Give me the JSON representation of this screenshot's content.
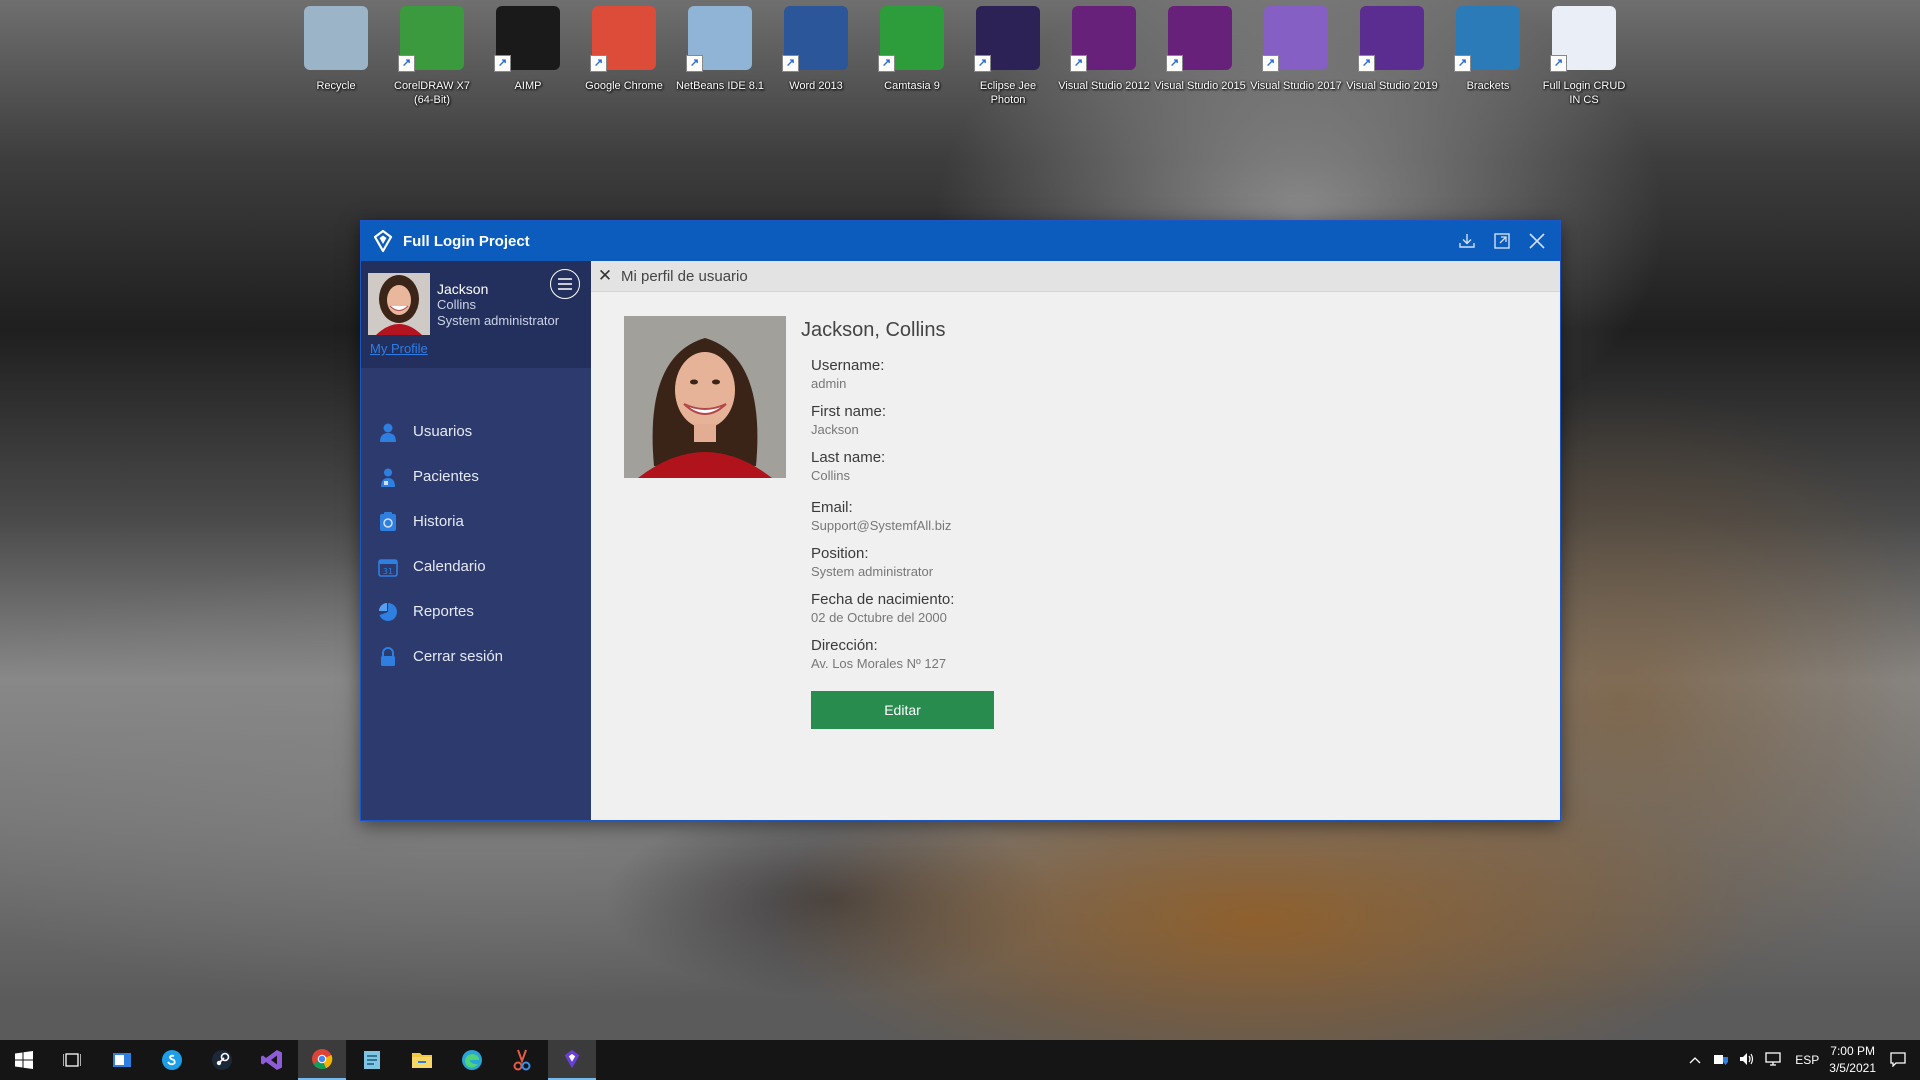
{
  "desktop": {
    "icons": [
      {
        "label": "Recycle",
        "icon": "recycle-bin-icon",
        "color": "#9cb4c8"
      },
      {
        "label": "CorelDRAW X7 (64-Bit)",
        "icon": "coreldraw-icon",
        "color": "#3b9a3e"
      },
      {
        "label": "AIMP",
        "icon": "aimp-icon",
        "color": "#1a1a1a"
      },
      {
        "label": "Google Chrome",
        "icon": "chrome-icon",
        "color": "#dd4b39"
      },
      {
        "label": "NetBeans IDE 8.1",
        "icon": "netbeans-icon",
        "color": "#8fb4d6"
      },
      {
        "label": "Word 2013",
        "icon": "word-icon",
        "color": "#2b579a"
      },
      {
        "label": "Camtasia 9",
        "icon": "camtasia-icon",
        "color": "#2d9c3b"
      },
      {
        "label": "Eclipse Jee Photon",
        "icon": "eclipse-icon",
        "color": "#2c2255"
      },
      {
        "label": "Visual Studio 2012",
        "icon": "visual-studio-icon",
        "color": "#68217a"
      },
      {
        "label": "Visual Studio 2015",
        "icon": "visual-studio-icon",
        "color": "#68217a"
      },
      {
        "label": "Visual Studio 2017",
        "icon": "visual-studio-icon",
        "color": "#865fc5"
      },
      {
        "label": "Visual Studio 2019",
        "icon": "visual-studio-icon",
        "color": "#5c2d91"
      },
      {
        "label": "Brackets",
        "icon": "brackets-icon",
        "color": "#2b7bb9"
      },
      {
        "label": "Full Login CRUD IN CS",
        "icon": "app-logo-icon",
        "color": "#e9eef7"
      }
    ]
  },
  "window": {
    "title": "Full Login Project",
    "accent": "#0b5cbd"
  },
  "sidebar": {
    "profile": {
      "first_name": "Jackson",
      "last_name": "Collins",
      "position": "System administrator",
      "link": "My Profile"
    },
    "items": [
      {
        "label": "Usuarios",
        "icon": "user-icon"
      },
      {
        "label": "Pacientes",
        "icon": "patient-icon"
      },
      {
        "label": "Historia",
        "icon": "history-icon"
      },
      {
        "label": "Calendario",
        "icon": "calendar-icon"
      },
      {
        "label": "Reportes",
        "icon": "reports-icon"
      },
      {
        "label": "Cerrar sesión",
        "icon": "lock-icon"
      }
    ]
  },
  "content": {
    "header_title": "Mi perfil de usuario",
    "full_name": "Jackson, Collins",
    "fields": [
      {
        "label": "Username:",
        "value": "admin"
      },
      {
        "label": "First name:",
        "value": "Jackson"
      },
      {
        "label": "Last name:",
        "value": "Collins"
      },
      {
        "label": "Email:",
        "value": "Support@SystemfAll.biz"
      },
      {
        "label": "Position:",
        "value": "System administrator"
      },
      {
        "label": "Fecha de nacimiento:",
        "value": "02 de Octubre del 2000"
      },
      {
        "label": "Dirección:",
        "value": "Av. Los Morales Nº 127"
      }
    ],
    "edit_label": "Editar",
    "edit_color": "#288c4f"
  },
  "taskbar": {
    "apps": [
      "start-icon",
      "task-view-icon",
      "widget-icon",
      "skype-icon",
      "steam-icon",
      "visual-studio-icon",
      "chrome-icon",
      "notepad-icon",
      "file-explorer-icon",
      "edge-icon",
      "snipping-icon",
      "app-logo-icon"
    ],
    "language": "ESP",
    "time": "7:00 PM",
    "date": "3/5/2021"
  }
}
